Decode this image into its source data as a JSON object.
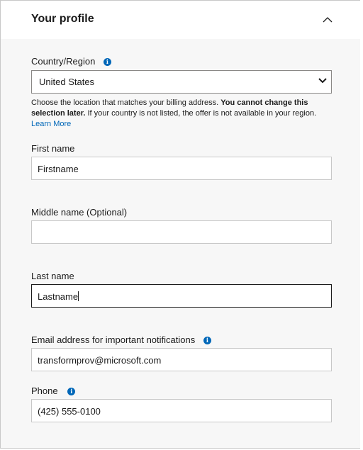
{
  "section": {
    "title": "Your profile"
  },
  "country": {
    "label": "Country/Region",
    "selected": "United States",
    "help_prefix": "Choose the location that matches your billing address. ",
    "help_bold": "You cannot change this selection later.",
    "help_suffix": " If your country is not listed, the offer is not available in your region.",
    "learn_more": "Learn More"
  },
  "first_name": {
    "label": "First name",
    "value": "Firstname"
  },
  "middle_name": {
    "label": "Middle name (Optional)",
    "value": ""
  },
  "last_name": {
    "label": "Last name",
    "value": "Lastname"
  },
  "email": {
    "label": "Email address for important notifications",
    "value": "transformprov@microsoft.com"
  },
  "phone": {
    "label": "Phone",
    "value": "(425) 555-0100"
  },
  "colors": {
    "accent": "#0067b8",
    "panel_bg": "#f7f7f7",
    "border": "#c8c8c8",
    "focus_border": "#1b1b1b"
  },
  "icons": {
    "collapse": "chevron-up-icon",
    "info": "info-icon",
    "dropdown": "chevron-down-icon"
  }
}
